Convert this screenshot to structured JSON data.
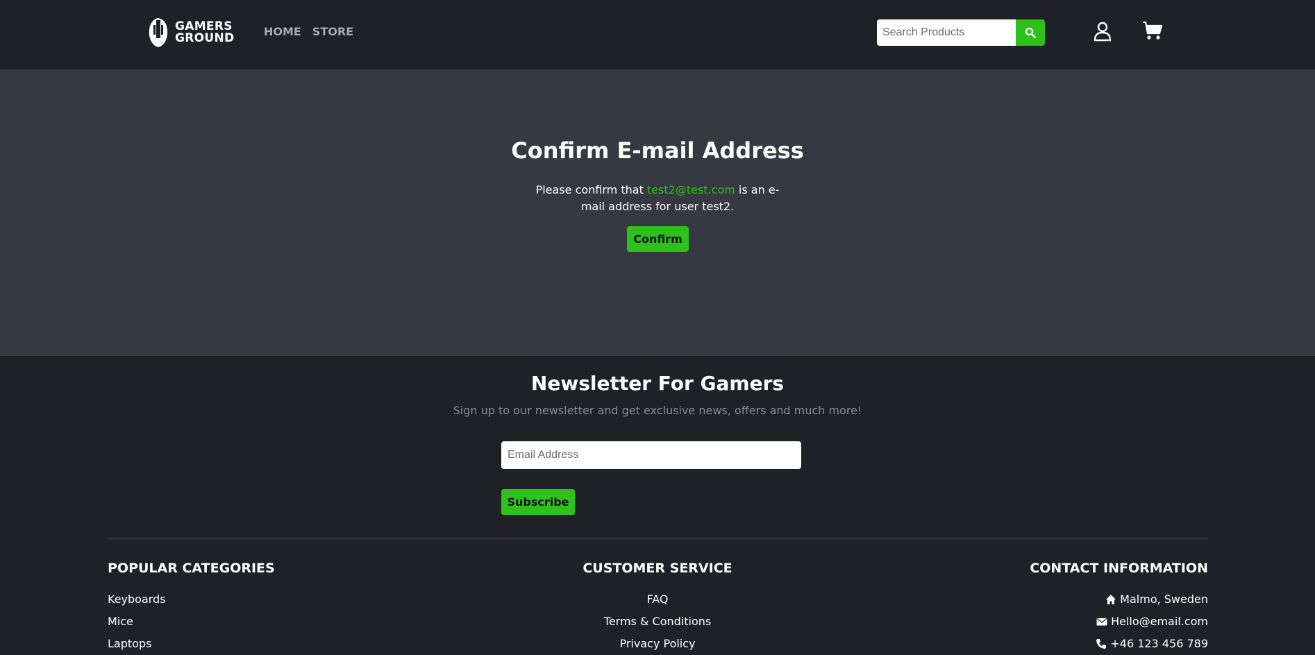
{
  "header": {
    "logo_line1": "GAMERS",
    "logo_line2": "GROUND",
    "nav": [
      "HOME",
      "STORE"
    ],
    "search_placeholder": "Search Products"
  },
  "hero": {
    "title": "Confirm E-mail Address",
    "text_before": "Please confirm that ",
    "email": "test2@test.com",
    "text_after": " is an e-mail address for user test2.",
    "confirm_label": "Confirm"
  },
  "newsletter": {
    "title": "Newsletter For Gamers",
    "subtitle": "Sign up to our newsletter and get exclusive news, offers and much more!",
    "email_placeholder": "Email Address",
    "subscribe_label": "Subscribe"
  },
  "footer": {
    "categories": {
      "title": "POPULAR CATEGORIES",
      "items": [
        "Keyboards",
        "Mice",
        "Laptops"
      ]
    },
    "service": {
      "title": "CUSTOMER SERVICE",
      "items": [
        "FAQ",
        "Terms & Conditions",
        "Privacy Policy"
      ]
    },
    "contact": {
      "title": "CONTACT INFORMATION",
      "items": [
        {
          "icon": "home-icon",
          "text": "Malmo, Sweden"
        },
        {
          "icon": "envelope-icon",
          "text": "Hello@email.com"
        },
        {
          "icon": "phone-icon",
          "text": "+46 123 456 789"
        }
      ]
    }
  },
  "colors": {
    "accent": "#2ec11b",
    "header_bg": "#202126",
    "hero_bg": "#363842"
  }
}
